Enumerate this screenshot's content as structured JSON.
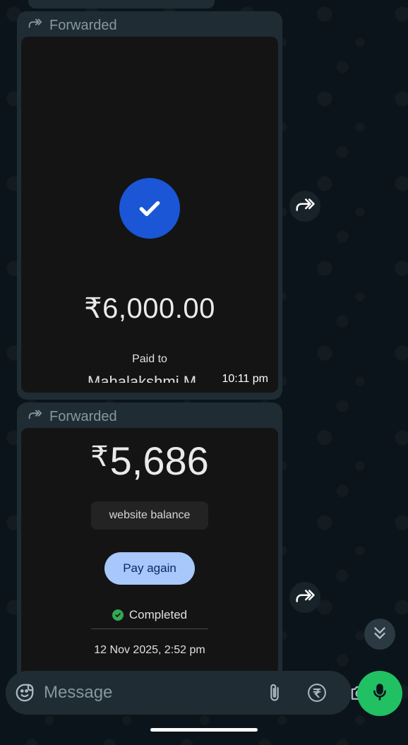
{
  "messages": [
    {
      "forwarded_label": "Forwarded",
      "amount": "₹6,000.00",
      "paid_to_label": "Paid to",
      "payee": "Mahalakshmi M",
      "time": "10:11 pm"
    },
    {
      "forwarded_label": "Forwarded",
      "currency": "₹",
      "amount": "5,686",
      "note": "website balance",
      "pay_again_label": "Pay again",
      "status": "Completed",
      "datetime": "12 Nov 2025, 2:52 pm"
    }
  ],
  "composer": {
    "placeholder": "Message"
  },
  "colors": {
    "background": "#0b141a",
    "bubble": "#1f2c33",
    "check_blue": "#1a56d6",
    "pay_again": "#a8c7fa",
    "status_green": "#34a853",
    "mic_green": "#21c063"
  },
  "icons": [
    "forward-icon",
    "checkmark-icon",
    "share-icon",
    "double-chevron-down-icon",
    "sticker-icon",
    "attach-icon",
    "rupee-icon",
    "camera-icon",
    "mic-icon"
  ]
}
